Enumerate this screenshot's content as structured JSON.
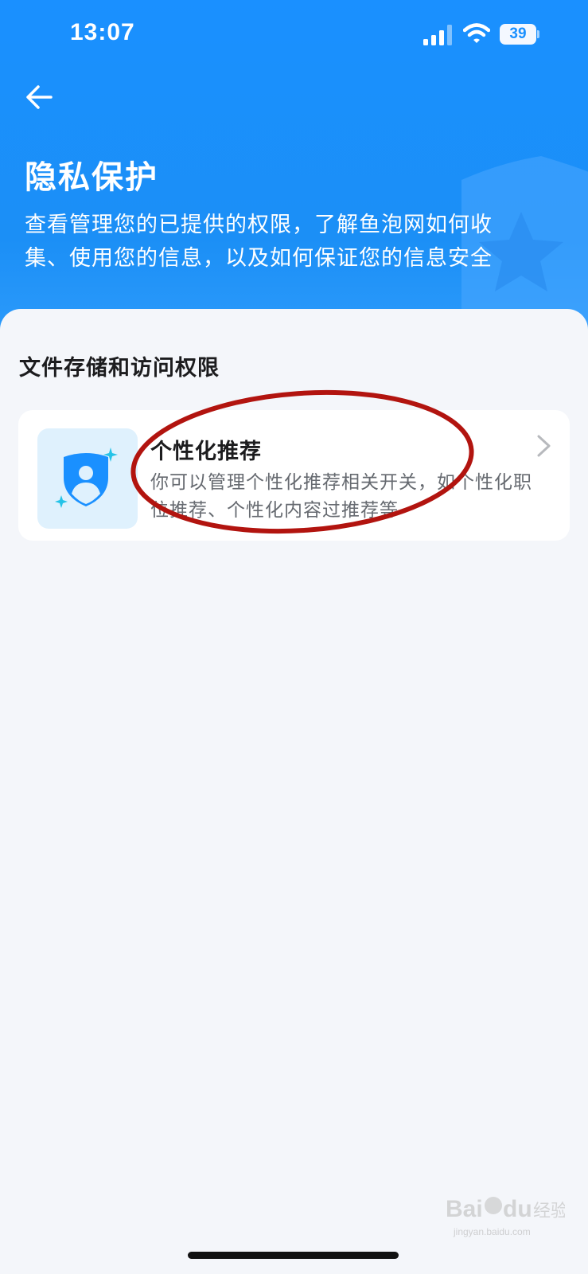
{
  "status_bar": {
    "time": "13:07",
    "battery_level": "39",
    "icons": [
      "signal-icon",
      "wifi-icon",
      "battery-icon"
    ]
  },
  "header": {
    "back_icon": "arrow-left-icon",
    "title": "隐私保护",
    "description": "查看管理您的已提供的权限，了解鱼泡网如何收集、使用您的信息，以及如何保证您的信息安全",
    "decoration_icon": "shield-star-icon"
  },
  "section": {
    "title": "文件存储和访问权限",
    "items": [
      {
        "icon": "shield-user-icon",
        "title": "个性化推荐",
        "description": "你可以管理个性化推荐相关开关，如个性化职位推荐、个性化内容过推荐等",
        "chevron_icon": "chevron-right-icon"
      }
    ]
  },
  "watermark": {
    "text": "Baidu经验",
    "sub_text": "jingyan.baidu.com"
  },
  "colors": {
    "header_blue": "#1a90ff",
    "background": "#f4f6fa",
    "card_bg": "#ffffff",
    "icon_bg": "#dff1fd",
    "annotation_red": "#b2140f"
  }
}
